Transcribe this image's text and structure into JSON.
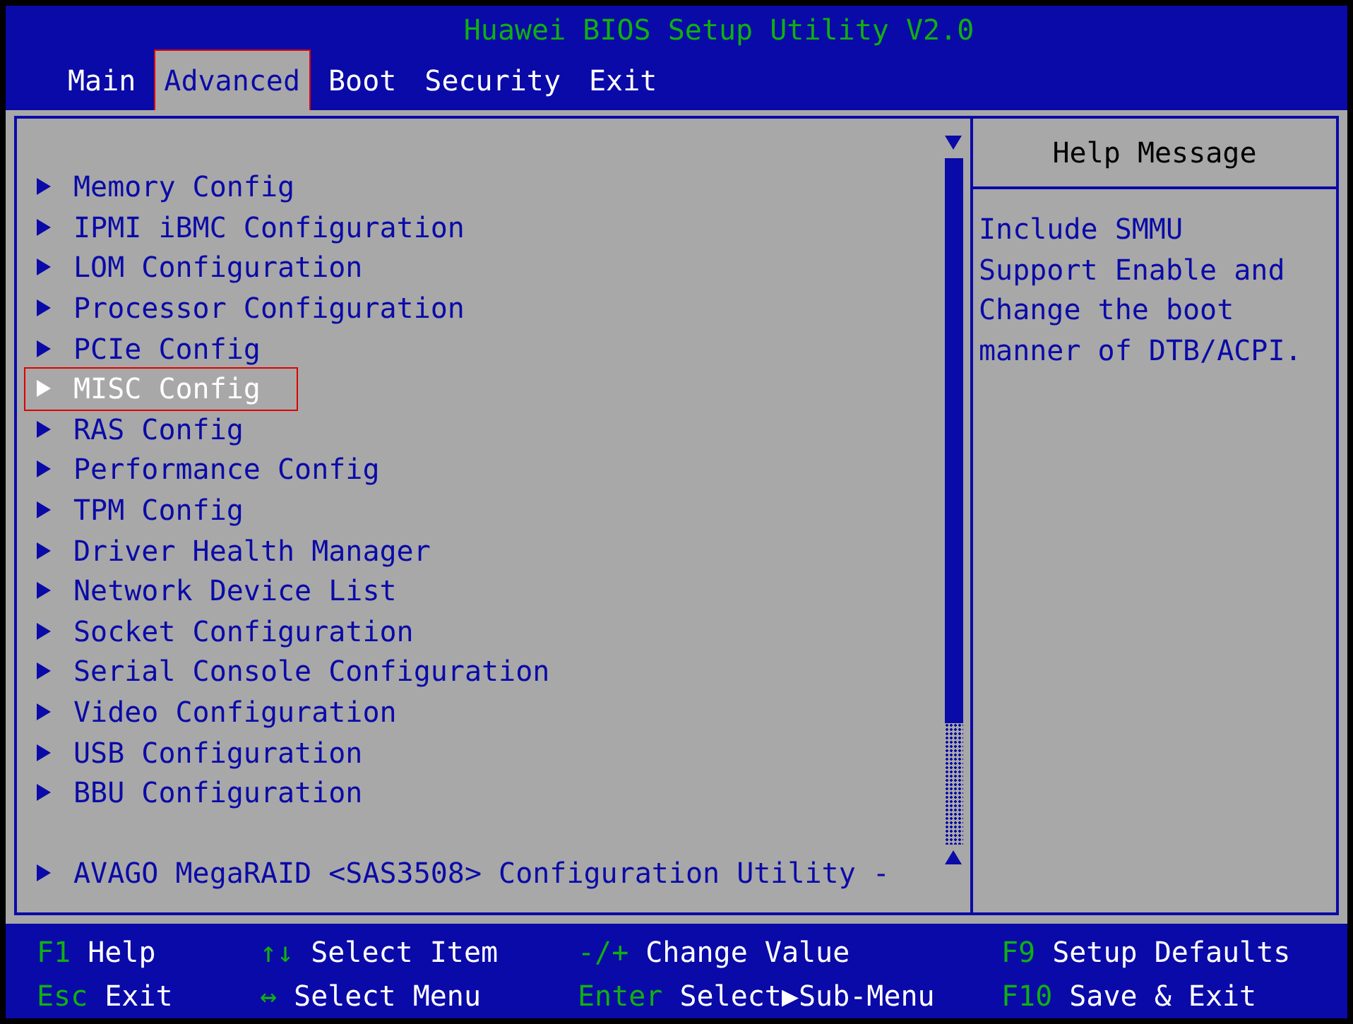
{
  "title": "Huawei BIOS Setup Utility V2.0",
  "tabs": [
    {
      "label": "Main",
      "selected": false,
      "outlined": false
    },
    {
      "label": "Advanced",
      "selected": true,
      "outlined": true
    },
    {
      "label": "Boot",
      "selected": false,
      "outlined": false
    },
    {
      "label": "Security",
      "selected": false,
      "outlined": false
    },
    {
      "label": "Exit",
      "selected": false,
      "outlined": false
    }
  ],
  "menu_items": [
    {
      "label": "Memory Config",
      "selected": false,
      "outlined": false
    },
    {
      "label": "IPMI iBMC Configuration",
      "selected": false,
      "outlined": false
    },
    {
      "label": "LOM Configuration",
      "selected": false,
      "outlined": false
    },
    {
      "label": "Processor Configuration",
      "selected": false,
      "outlined": false
    },
    {
      "label": "PCIe Config",
      "selected": false,
      "outlined": false
    },
    {
      "label": "MISC Config",
      "selected": true,
      "outlined": true
    },
    {
      "label": "RAS Config",
      "selected": false,
      "outlined": false
    },
    {
      "label": "Performance Config",
      "selected": false,
      "outlined": false
    },
    {
      "label": "TPM Config",
      "selected": false,
      "outlined": false
    },
    {
      "label": "Driver Health Manager",
      "selected": false,
      "outlined": false
    },
    {
      "label": "Network Device List",
      "selected": false,
      "outlined": false
    },
    {
      "label": "Socket Configuration",
      "selected": false,
      "outlined": false
    },
    {
      "label": "Serial Console Configuration",
      "selected": false,
      "outlined": false
    },
    {
      "label": "Video Configuration",
      "selected": false,
      "outlined": false
    },
    {
      "label": "USB Configuration",
      "selected": false,
      "outlined": false
    },
    {
      "label": "BBU Configuration",
      "selected": false,
      "outlined": false
    }
  ],
  "bottom_item": {
    "label": "AVAGO MegaRAID <SAS3508> Configuration Utility -",
    "selected": false,
    "outlined": false
  },
  "help": {
    "title": "Help Message",
    "lines": [
      "Include SMMU",
      "Support Enable and",
      "Change the boot",
      "manner of DTB/ACPI."
    ]
  },
  "key_hints": [
    {
      "key": "F1",
      "action": "Help"
    },
    {
      "key": "Esc",
      "action": "Exit"
    },
    {
      "key": "↑↓",
      "action": "Select Item"
    },
    {
      "key": "↔",
      "action": "Select Menu"
    },
    {
      "key": "-/+",
      "action": "Change Value"
    },
    {
      "key": "Enter",
      "action": "Select▶Sub-Menu"
    },
    {
      "key": "F9",
      "action": "Setup Defaults"
    },
    {
      "key": "F10",
      "action": "Save & Exit"
    }
  ]
}
